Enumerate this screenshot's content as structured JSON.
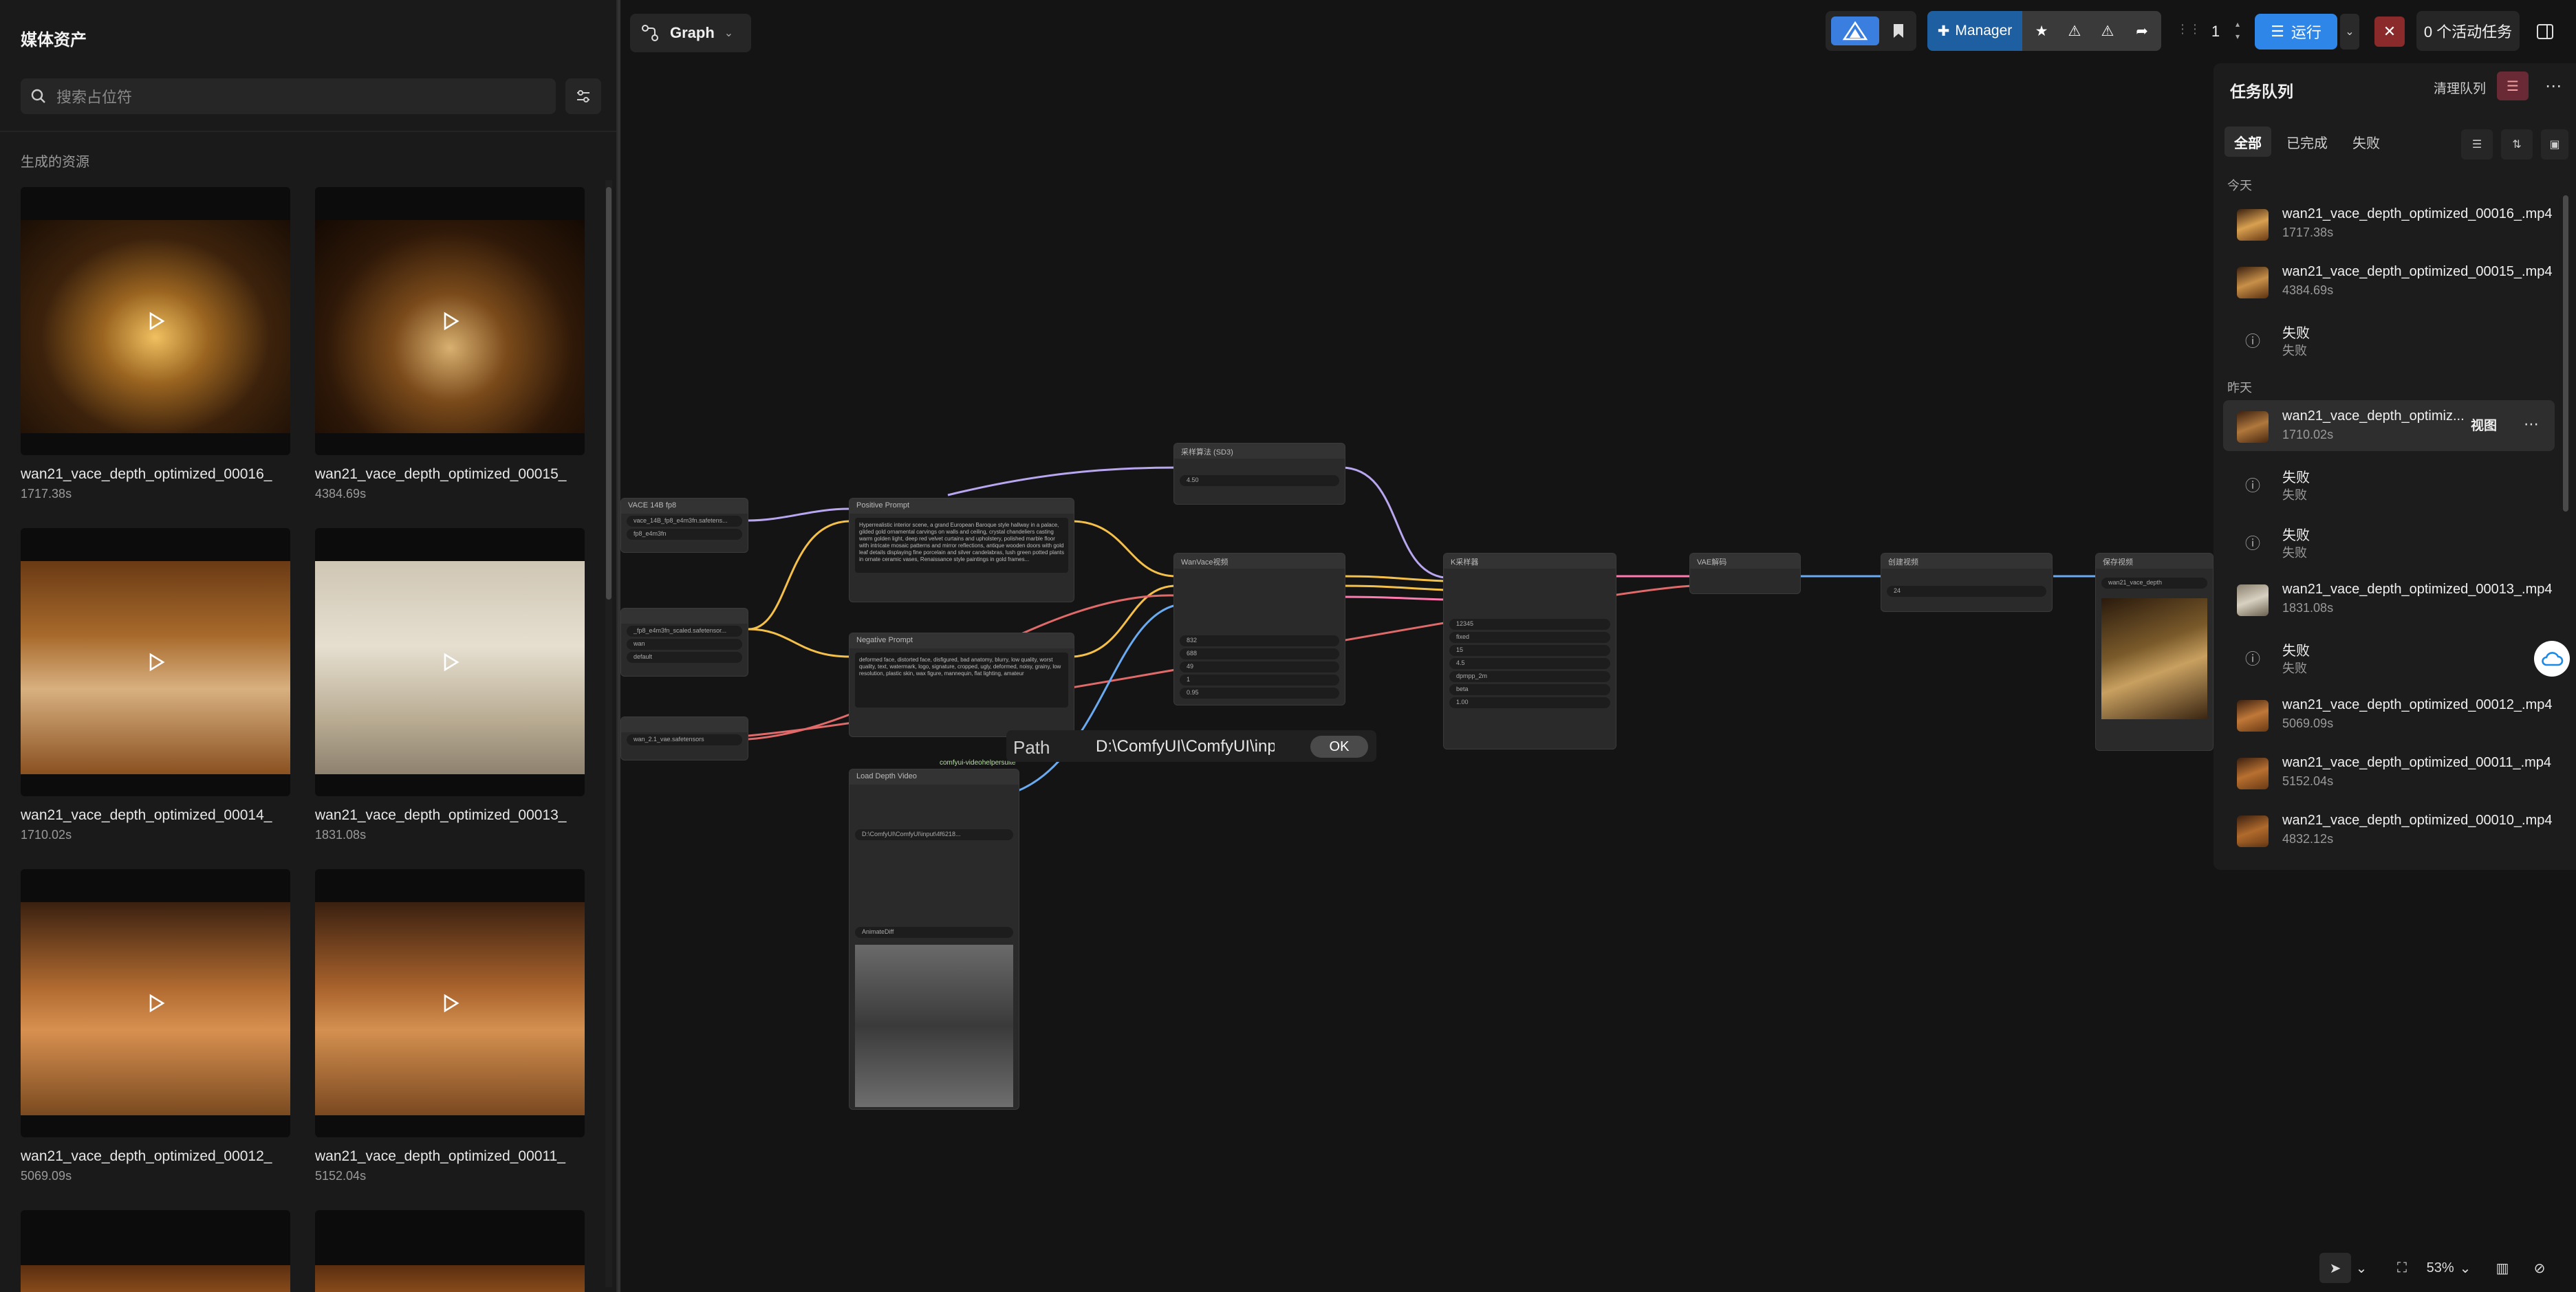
{
  "media_panel": {
    "title": "媒体资产",
    "search_placeholder": "搜索占位符",
    "section": "生成的资源",
    "items": [
      {
        "name": "wan21_vace_depth_optimized_00016_",
        "duration": "1717.38s"
      },
      {
        "name": "wan21_vace_depth_optimized_00015_",
        "duration": "4384.69s"
      },
      {
        "name": "wan21_vace_depth_optimized_00014_",
        "duration": "1710.02s"
      },
      {
        "name": "wan21_vace_depth_optimized_00013_",
        "duration": "1831.08s"
      },
      {
        "name": "wan21_vace_depth_optimized_00012_",
        "duration": "5069.09s"
      },
      {
        "name": "wan21_vace_depth_optimized_00011_",
        "duration": "5152.04s"
      },
      {
        "name": "",
        "duration": ""
      },
      {
        "name": "",
        "duration": ""
      }
    ]
  },
  "graph_tab": {
    "label": "Graph"
  },
  "toolbar": {
    "manager_label": "Manager",
    "batch_count": "1",
    "run_label": "运行",
    "active_jobs": "0 个活动任务"
  },
  "queue": {
    "title": "任务队列",
    "clear_label": "清理队列",
    "tabs": [
      "全部",
      "已完成",
      "失败"
    ],
    "today_label": "今天",
    "yesterday_label": "昨天",
    "view_label": "视图",
    "items": [
      {
        "title": "wan21_vace_depth_optimized_00016_.mp4",
        "sub": "1717.38s"
      },
      {
        "title": "wan21_vace_depth_optimized_00015_.mp4",
        "sub": "4384.69s"
      },
      {
        "title": "失败",
        "sub": "失败"
      },
      {
        "title": "wan21_vace_depth_optimiz...",
        "sub": "1710.02s"
      },
      {
        "title": "失败",
        "sub": "失败"
      },
      {
        "title": "失败",
        "sub": "失败"
      },
      {
        "title": "wan21_vace_depth_optimized_00013_.mp4",
        "sub": "1831.08s"
      },
      {
        "title": "失败",
        "sub": "失败"
      },
      {
        "title": "wan21_vace_depth_optimized_00012_.mp4",
        "sub": "5069.09s"
      },
      {
        "title": "wan21_vace_depth_optimized_00011_.mp4",
        "sub": "5152.04s"
      },
      {
        "title": "wan21_vace_depth_optimized_00010_.mp4",
        "sub": "4832.12s"
      }
    ]
  },
  "nodes": {
    "model_loader": {
      "title": "VACE 14B fp8",
      "w1": "vace_14B_fp8_e4m3fn.safetens...",
      "w2": "fp8_e4m3fn"
    },
    "clip_loader": {
      "w1": "_fp8_e4m3fn_scaled.safetensor...",
      "w2": "wan",
      "w3": "default"
    },
    "vae_loader": {
      "w1": "wan_2.1_vae.safetensors"
    },
    "positive": {
      "title": "Positive Prompt",
      "text": "Hyperrealistic interior scene, a grand European Baroque style hallway in a palace, gilded gold ornamental carvings on walls and ceiling, crystal chandeliers casting warm golden light, deep red velvet curtains and upholstery, polished marble floor with intricate mosaic patterns and mirror reflections, antique wooden doors with gold leaf details displaying fine porcelain and silver candelabras, lush green potted plants in ornate ceramic vases, Renaissance style paintings in gold frames..."
    },
    "negative": {
      "title": "Negative Prompt",
      "text": "deformed face, distorted face, disfigured, bad anatomy, blurry, low quality, worst quality, text, watermark, logo, signature, cropped, ugly, deformed, noisy, grainy, low resolution, plastic skin, wax figure, mannequin, flat lighting, amateur"
    },
    "sampling": {
      "title": "采样算法 (SD3)",
      "shift": "4.50"
    },
    "wanvace": {
      "title": "WanVace视频",
      "width": "832",
      "height": "688",
      "length": "49",
      "batch": "1",
      "strength": "0.95"
    },
    "ksampler": {
      "title": "K采样器",
      "seed": "12345",
      "control": "fixed",
      "steps": "15",
      "cfg": "4.5",
      "sampler": "dpmpp_2m",
      "scheduler": "beta",
      "denoise": "1.00"
    },
    "vae_decode": {
      "title": "VAE解码"
    },
    "create_video": {
      "title": "创建视频",
      "fps": "24"
    },
    "save_video": {
      "title": "保存视频",
      "prefix": "wan21_vace_depth"
    },
    "load_video": {
      "title": "Load Depth Video",
      "path": "D:\\ComfyUI\\ComfyUI\\input\\4f6218...",
      "pack": "comfyui-videohelpersuite",
      "format": "AnimateDiff"
    }
  },
  "path_popup": {
    "label": "Path",
    "value": "D:\\ComfyUI\\ComfyUI\\input\\",
    "ok": "OK"
  },
  "zoom": {
    "level": "53%"
  },
  "colors": {
    "accent": "#2d86e8",
    "danger": "#c0392b",
    "manager": "#1d5fa0",
    "wire_yellow": "#f5c04a",
    "wire_purple": "#b9a6f0",
    "wire_red": "#e06a6a",
    "wire_pink": "#ff7ab0",
    "wire_blue": "#6aaaf0"
  }
}
